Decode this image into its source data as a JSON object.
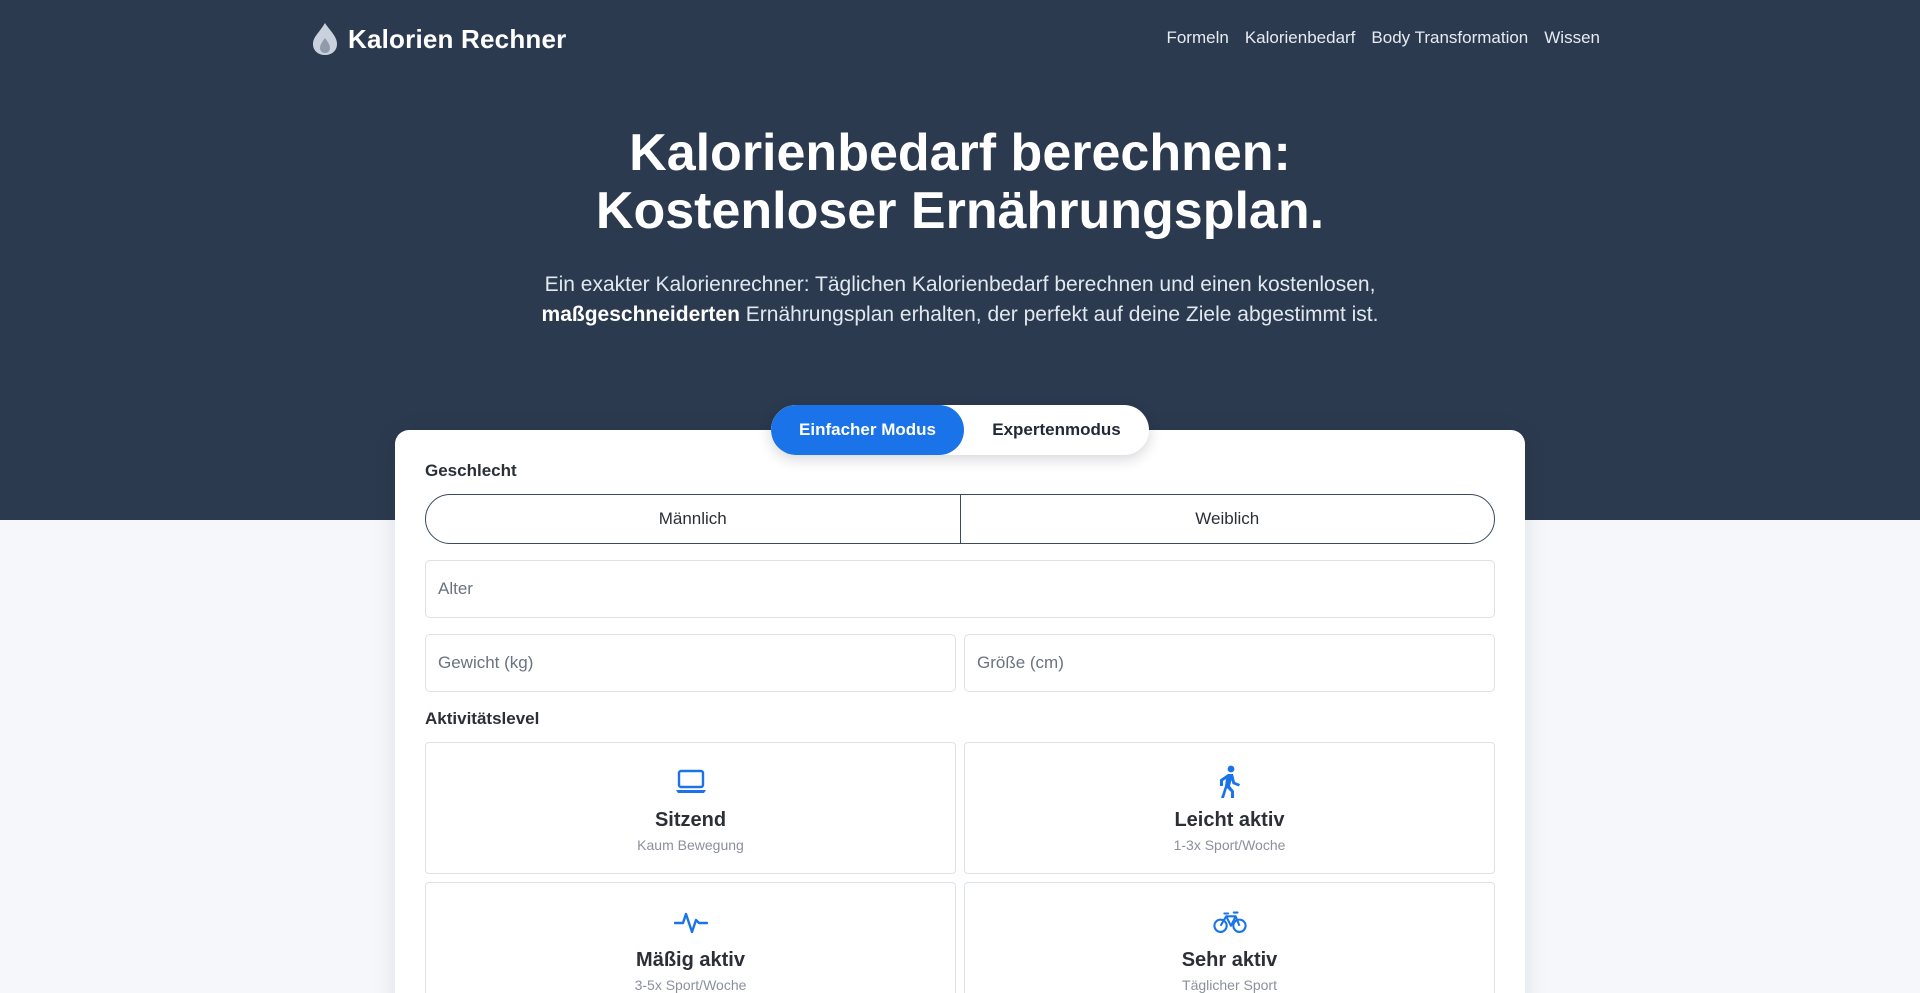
{
  "brand": {
    "name": "Kalorien Rechner",
    "logo_icon": "flame-icon"
  },
  "nav": {
    "links": [
      "Formeln",
      "Kalorienbedarf",
      "Body Transformation",
      "Wissen"
    ]
  },
  "hero": {
    "title_line1": "Kalorienbedarf berechnen:",
    "title_line2": "Kostenloser Ernährungsplan.",
    "subtitle_pre": "Ein exakter Kalorienrechner: Täglichen Kalorienbedarf berechnen und einen kostenlosen,",
    "subtitle_bold": "maßgeschneiderten",
    "subtitle_post": "Ernährungsplan erhalten, der perfekt auf deine Ziele abgestimmt ist."
  },
  "modes": {
    "simple": "Einfacher Modus",
    "expert": "Expertenmodus",
    "selected": "simple"
  },
  "form": {
    "gender_label": "Geschlecht",
    "gender_options": [
      "Männlich",
      "Weiblich"
    ],
    "age_placeholder": "Alter",
    "weight_placeholder": "Gewicht (kg)",
    "height_placeholder": "Größe (cm)",
    "activity_label": "Aktivitätslevel",
    "activities": [
      {
        "title": "Sitzend",
        "desc": "Kaum Bewegung",
        "icon": "laptop-icon"
      },
      {
        "title": "Leicht aktiv",
        "desc": "1-3x Sport/Woche",
        "icon": "walking-icon"
      },
      {
        "title": "Mäßig aktiv",
        "desc": "3-5x Sport/Woche",
        "icon": "pulse-icon"
      },
      {
        "title": "Sehr aktiv",
        "desc": "Täglicher Sport",
        "icon": "bicycle-icon"
      }
    ]
  },
  "colors": {
    "hero_bg": "#2c3a4f",
    "accent": "#1a73e8",
    "page_bg": "#f5f7fa"
  }
}
